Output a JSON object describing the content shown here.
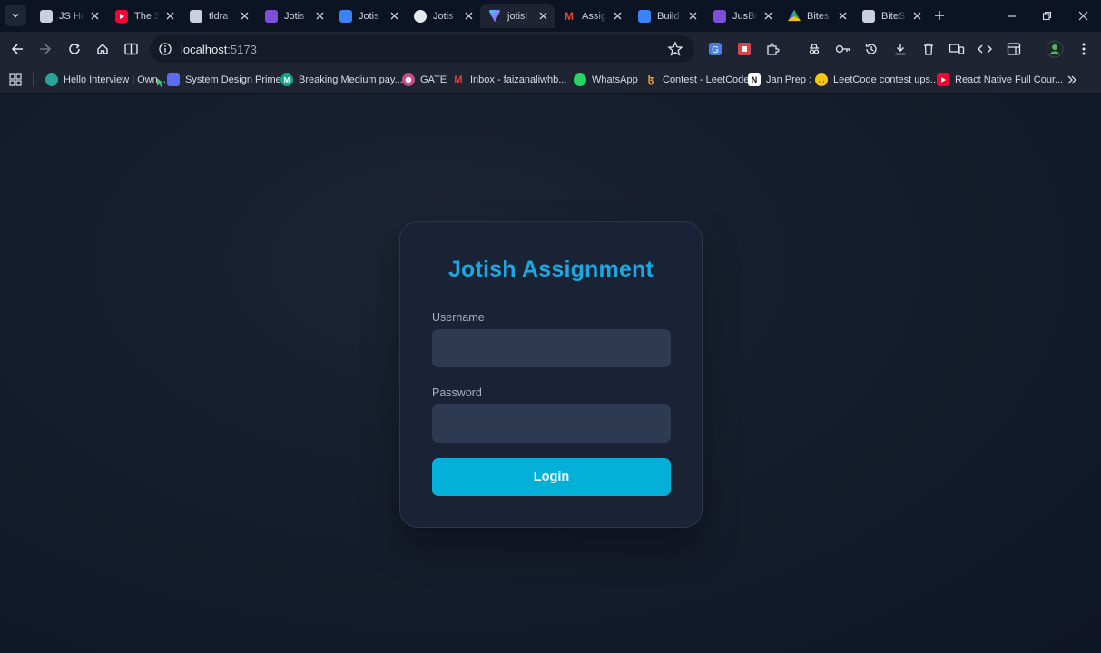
{
  "tabs": [
    {
      "title": "JS Ho",
      "icon": "image-icon"
    },
    {
      "title": "The S",
      "icon": "youtube-icon"
    },
    {
      "title": "tldra",
      "icon": "image-icon"
    },
    {
      "title": "Jotis",
      "icon": "list-icon"
    },
    {
      "title": "Jotis",
      "icon": "docs-icon"
    },
    {
      "title": "Jotis",
      "icon": "chatgpt-icon"
    },
    {
      "title": "jotisl",
      "icon": "vite-icon",
      "active": true
    },
    {
      "title": "Assig",
      "icon": "gmail-icon"
    },
    {
      "title": "Build",
      "icon": "docs-icon"
    },
    {
      "title": "JusBi",
      "icon": "list-icon"
    },
    {
      "title": "Bites",
      "icon": "drive-icon"
    },
    {
      "title": "BiteS",
      "icon": "image-icon"
    }
  ],
  "address": {
    "host": "localhost",
    "port": ":5173"
  },
  "bookmarks": [
    {
      "label": "Hello Interview | Own...",
      "icon": "hello-interview-icon"
    },
    {
      "label": "System Design Primer",
      "icon": "system-design-icon"
    },
    {
      "label": "Breaking Medium pay...",
      "icon": "medium-icon"
    },
    {
      "label": "GATE",
      "icon": "gate-icon"
    },
    {
      "label": "Inbox - faizanaliwhb...",
      "icon": "gmail-icon"
    },
    {
      "label": "WhatsApp",
      "icon": "whatsapp-icon"
    },
    {
      "label": "Contest - LeetCode",
      "icon": "leetcode-icon"
    },
    {
      "label": "Jan Prep :",
      "icon": "notion-icon"
    },
    {
      "label": "LeetCode contest ups...",
      "icon": "smiley-icon"
    },
    {
      "label": "React Native Full Cour...",
      "icon": "youtube-icon"
    }
  ],
  "login": {
    "title": "Jotish Assignment",
    "username_label": "Username",
    "username_value": "",
    "password_label": "Password",
    "password_value": "",
    "button_label": "Login"
  },
  "colors": {
    "accent": "#1aa8e0",
    "button": "#03b0d8",
    "card": "#1a2336",
    "input": "#2e3a52"
  }
}
